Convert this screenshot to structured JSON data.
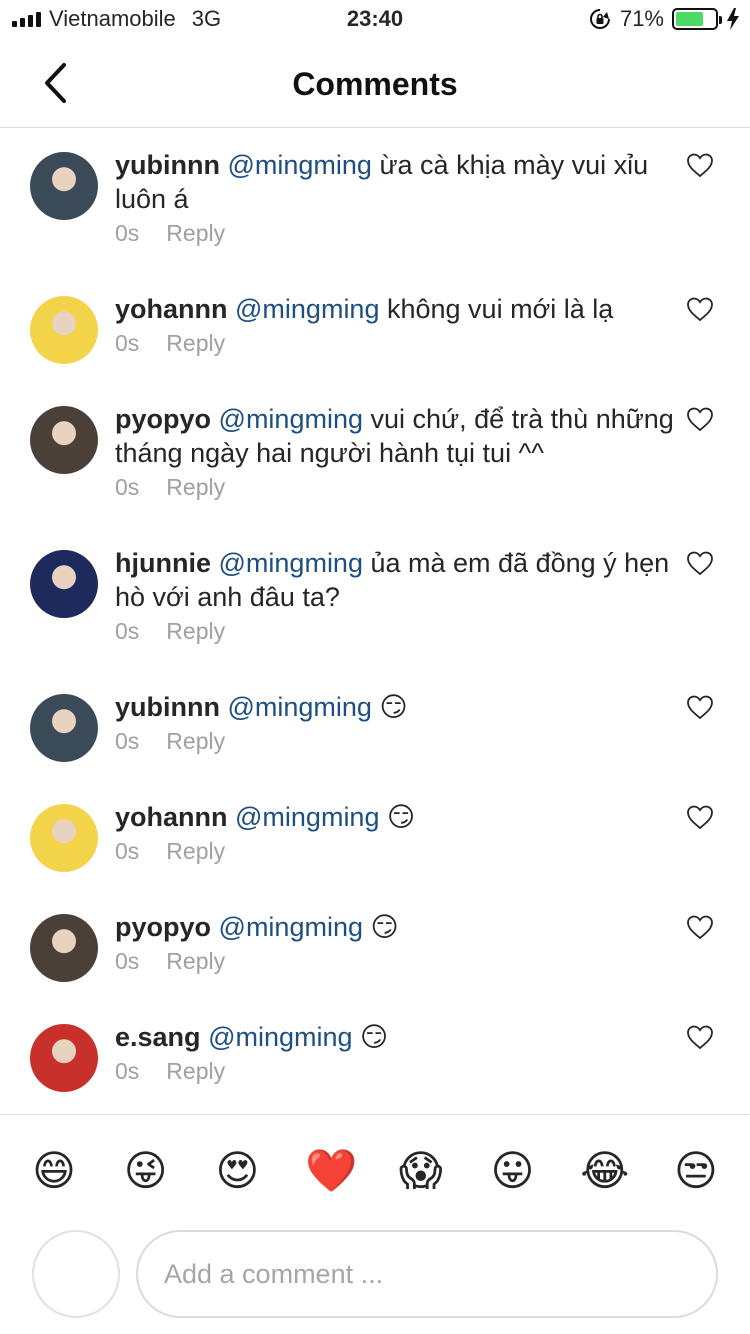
{
  "status_bar": {
    "carrier": "Vietnamobile",
    "network": "3G",
    "time": "23:40",
    "battery_percent": "71%",
    "battery_level": 0.71,
    "battery_color": "#4cd964"
  },
  "header": {
    "title": "Comments",
    "back_icon": "chevron-left-icon"
  },
  "colors": {
    "mention": "#1d4f80",
    "meta": "#a0a0a0",
    "divider": "#dbdbdb"
  },
  "comments": [
    {
      "username": "yubinnn",
      "mention": "@mingming",
      "text": "ừa cà khịa mày vui xỉu luôn á",
      "time": "0s",
      "reply": "Reply",
      "avatar_color": "#3b4a57"
    },
    {
      "username": "yohannn",
      "mention": "@mingming",
      "text": "không vui mới là lạ",
      "time": "0s",
      "reply": "Reply",
      "avatar_color": "#f2d34a"
    },
    {
      "username": "pyopyo",
      "mention": "@mingming",
      "text": "vui chứ, để trà thù những tháng ngày hai người hành tụi tui ^^",
      "time": "0s",
      "reply": "Reply",
      "avatar_color": "#4a4038"
    },
    {
      "username": "hjunnie",
      "mention": "@mingming",
      "text": "ủa mà em đã đồng ý hẹn hò với anh đâu ta?",
      "time": "0s",
      "reply": "Reply",
      "avatar_color": "#1f2a5c"
    },
    {
      "username": "yubinnn",
      "mention": "@mingming",
      "text": "😏",
      "time": "0s",
      "reply": "Reply",
      "avatar_color": "#3b4a57"
    },
    {
      "username": "yohannn",
      "mention": "@mingming",
      "text": "😏",
      "time": "0s",
      "reply": "Reply",
      "avatar_color": "#f2d34a"
    },
    {
      "username": "pyopyo",
      "mention": "@mingming",
      "text": "😏",
      "time": "0s",
      "reply": "Reply",
      "avatar_color": "#4a4038"
    },
    {
      "username": "e.sang",
      "mention": "@mingming",
      "text": "😏",
      "time": "0s",
      "reply": "Reply",
      "avatar_color": "#c8302c"
    }
  ],
  "emoji_bar": [
    "😄",
    "😜",
    "😍",
    "❤️",
    "😱",
    "😛",
    "😂",
    "😒"
  ],
  "composer": {
    "placeholder": "Add a comment ..."
  }
}
